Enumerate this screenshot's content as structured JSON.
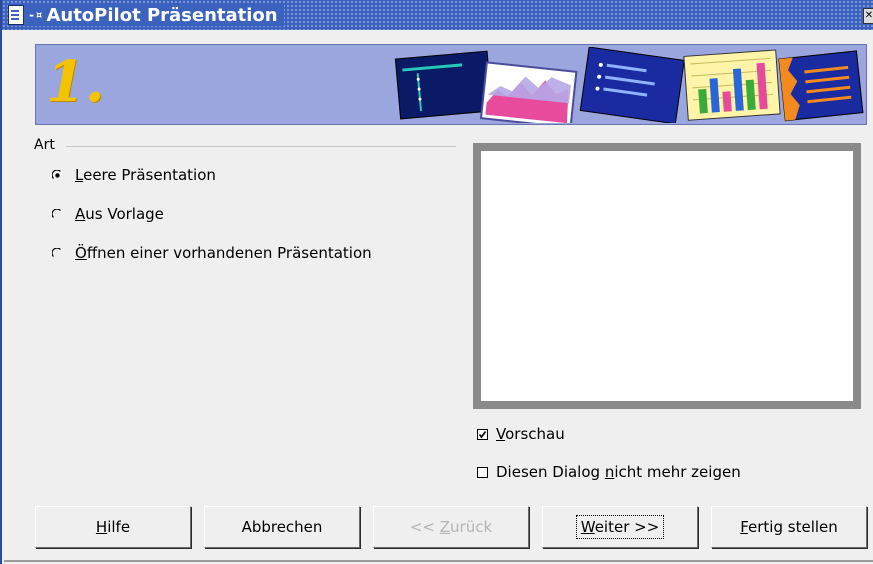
{
  "window": {
    "title": "AutoPilot Präsentation"
  },
  "banner": {
    "step_number": "1."
  },
  "group": {
    "label": "Art",
    "options": [
      {
        "label": "Leere Präsentation",
        "underline": "L",
        "rest": "eere Präsentation",
        "selected": true
      },
      {
        "label": "Aus Vorlage",
        "underline": "A",
        "rest": "us Vorlage",
        "selected": false
      },
      {
        "label": "Öffnen einer vorhandenen Präsentation",
        "underline": "Ö",
        "rest": "ffnen einer vorhandenen Präsentation",
        "selected": false
      }
    ]
  },
  "preview_checkbox": {
    "label": "Vorschau",
    "underline": "V",
    "rest": "orschau",
    "checked": true
  },
  "dont_show_checkbox": {
    "label": "Diesen Dialog nicht mehr zeigen",
    "pre": "Diesen Dialog ",
    "underline": "n",
    "rest": "icht mehr zeigen",
    "checked": false
  },
  "buttons": {
    "help": {
      "label": "Hilfe",
      "underline": "H",
      "rest": "ilfe"
    },
    "cancel": {
      "label": "Abbrechen"
    },
    "back": {
      "label": "<< Zurück",
      "pre": "<< ",
      "underline": "Z",
      "rest": "urück",
      "disabled": true
    },
    "next": {
      "label": "Weiter >>",
      "underline": "W",
      "rest": "eiter >>",
      "default": true
    },
    "finish": {
      "label": "Fertig stellen",
      "underline": "F",
      "rest": "ertig stellen"
    }
  },
  "colors": {
    "titlebar": "#3c62c0",
    "banner": "#9ba6de",
    "step_number": "#f5c400"
  },
  "icons": [
    "document-icon",
    "pin-icon",
    "close-icon",
    "radio-icon",
    "checkbox-icon"
  ]
}
